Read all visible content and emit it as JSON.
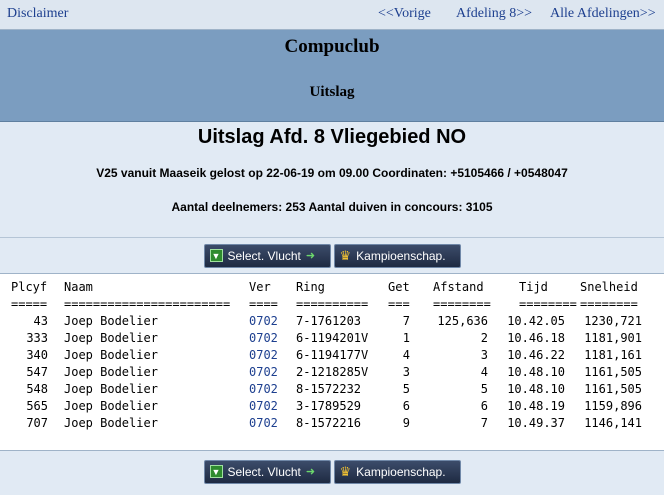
{
  "nav": {
    "disclaimer": "Disclaimer",
    "prev": "<<Vorige",
    "afdeling": "Afdeling 8>>",
    "all": "Alle Afdelingen>>"
  },
  "banner": {
    "club": "Compuclub",
    "subtitle": "Uitslag"
  },
  "race": {
    "title": "Uitslag Afd. 8 Vliegebied NO",
    "details": "V25 vanuit Maaseik gelost op 22-06-19 om 09.00 Coordinaten: +5105466 / +0548047",
    "counts": "Aantal deelnemers: 253 Aantal duiven in concours: 3105"
  },
  "buttons": {
    "vlucht": "Select. Vlucht",
    "kampioen": "Kampioenschap."
  },
  "colors": {
    "banner": "#7b9dc0",
    "background": "#e1eaf4",
    "link": "#1d3f8f"
  },
  "table": {
    "headers": [
      "Plcyf",
      "Naam",
      "Ver",
      "Ring",
      "Get",
      "Afstand",
      "Tijd",
      "Snelheid"
    ],
    "separators": [
      "=====",
      "=======================",
      "====",
      "==========",
      "===",
      "========",
      "========",
      "========"
    ],
    "rows": [
      [
        "43",
        "Joep Bodelier",
        "0702",
        "7-1761203",
        "7",
        "125,636",
        "10.42.05",
        "1230,721"
      ],
      [
        "333",
        "Joep Bodelier",
        "0702",
        "6-1194201V",
        "1",
        "2",
        "10.46.18",
        "1181,901"
      ],
      [
        "340",
        "Joep Bodelier",
        "0702",
        "6-1194177V",
        "4",
        "3",
        "10.46.22",
        "1181,161"
      ],
      [
        "547",
        "Joep Bodelier",
        "0702",
        "2-1218285V",
        "3",
        "4",
        "10.48.10",
        "1161,505"
      ],
      [
        "548",
        "Joep Bodelier",
        "0702",
        "8-1572232",
        "5",
        "5",
        "10.48.10",
        "1161,505"
      ],
      [
        "565",
        "Joep Bodelier",
        "0702",
        "3-1789529",
        "6",
        "6",
        "10.48.19",
        "1159,896"
      ],
      [
        "707",
        "Joep Bodelier",
        "0702",
        "8-1572216",
        "9",
        "7",
        "10.49.37",
        "1146,141"
      ]
    ]
  }
}
